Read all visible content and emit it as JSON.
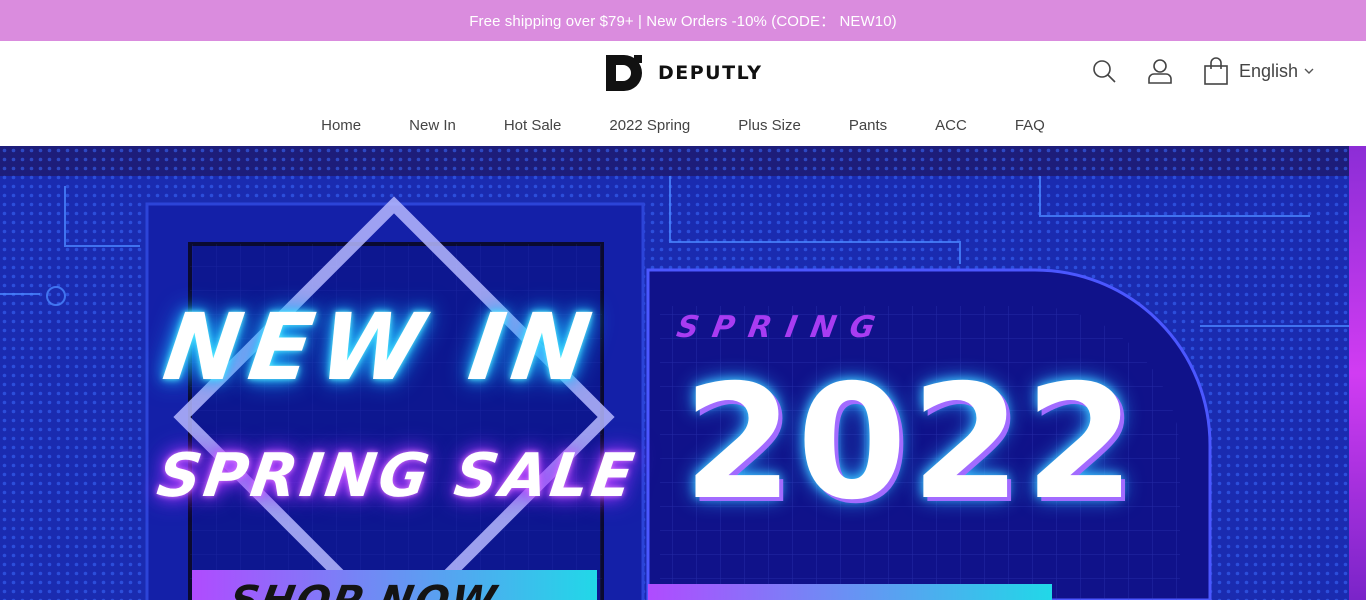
{
  "promo": {
    "text": "Free shipping over $79+ | New Orders -10%  (CODE： NEW10)"
  },
  "header": {
    "brand": "DEPUTLY",
    "language": "English",
    "icons": [
      "search-icon",
      "user-icon",
      "shopping-bag-icon",
      "chevron-down-icon"
    ]
  },
  "nav": {
    "items": [
      {
        "label": "Home"
      },
      {
        "label": "New In"
      },
      {
        "label": "Hot Sale"
      },
      {
        "label": "2022 Spring"
      },
      {
        "label": "Plus Size"
      },
      {
        "label": "Pants"
      },
      {
        "label": "ACC"
      },
      {
        "label": "FAQ"
      }
    ]
  },
  "hero": {
    "line1": "NEW IN",
    "line2": "SPRING SALE",
    "season": "SPRING",
    "year": "2022",
    "cta": "SHOP NOW"
  },
  "colors": {
    "promo_bg": "#da8cde",
    "hero_bg": "#1a1f9a",
    "accent_purple": "#a83cf2",
    "accent_cyan": "#22c7ff"
  }
}
